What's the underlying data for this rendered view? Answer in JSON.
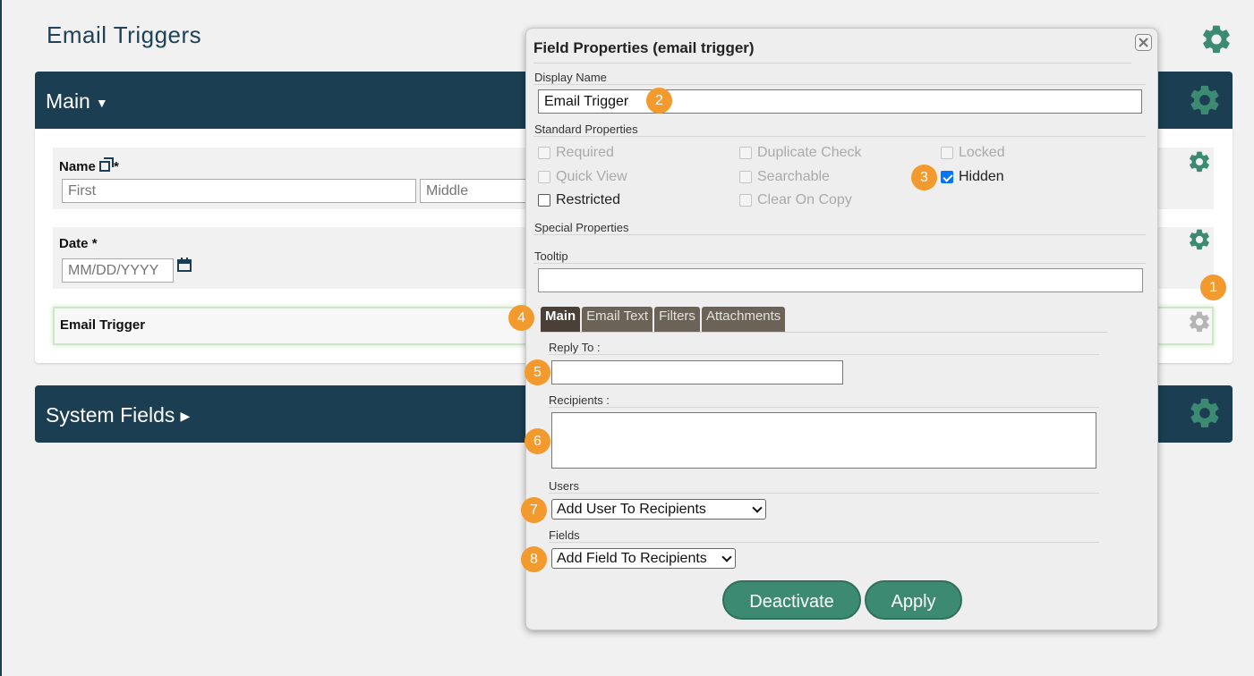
{
  "page": {
    "title": "Email Triggers"
  },
  "sections": {
    "main": {
      "title": "Main"
    },
    "system": {
      "title": "System Fields"
    }
  },
  "fields": {
    "name": {
      "label": "Name",
      "required_mark": "*",
      "first_placeholder": "First",
      "middle_placeholder": "Middle"
    },
    "date": {
      "label": "Date",
      "required_mark": "*",
      "placeholder": "MM/DD/YYYY"
    },
    "email_trigger": {
      "label": "Email Trigger"
    }
  },
  "dialog": {
    "title": "Field Properties (email trigger)",
    "display_name_label": "Display Name",
    "display_name_value": "Email Trigger",
    "standard_properties_label": "Standard Properties",
    "checkboxes": [
      {
        "label": "Required",
        "checked": false,
        "enabled": false
      },
      {
        "label": "Duplicate Check",
        "checked": false,
        "enabled": false
      },
      {
        "label": "Locked",
        "checked": false,
        "enabled": false
      },
      {
        "label": "Quick View",
        "checked": false,
        "enabled": false
      },
      {
        "label": "Searchable",
        "checked": false,
        "enabled": false
      },
      {
        "label": "Hidden",
        "checked": true,
        "enabled": true
      },
      {
        "label": "Restricted",
        "checked": false,
        "enabled": true
      },
      {
        "label": "Clear On Copy",
        "checked": false,
        "enabled": false
      }
    ],
    "special_properties_label": "Special Properties",
    "tooltip_label": "Tooltip",
    "tabs": [
      "Main",
      "Email Text",
      "Filters",
      "Attachments"
    ],
    "active_tab": "Main",
    "reply_to_label": "Reply To :",
    "recipients_label": "Recipients :",
    "users_label": "Users",
    "users_select": "Add User To Recipients",
    "fields_label": "Fields",
    "fields_select": "Add Field To Recipients",
    "deactivate_button": "Deactivate",
    "apply_button": "Apply"
  },
  "callouts": [
    "1",
    "2",
    "3",
    "4",
    "5",
    "6",
    "7",
    "8"
  ],
  "colors": {
    "header": "#1b3e52",
    "accent": "#3d8a72",
    "callout": "#f29a2e",
    "gear": "#3d8a72"
  }
}
